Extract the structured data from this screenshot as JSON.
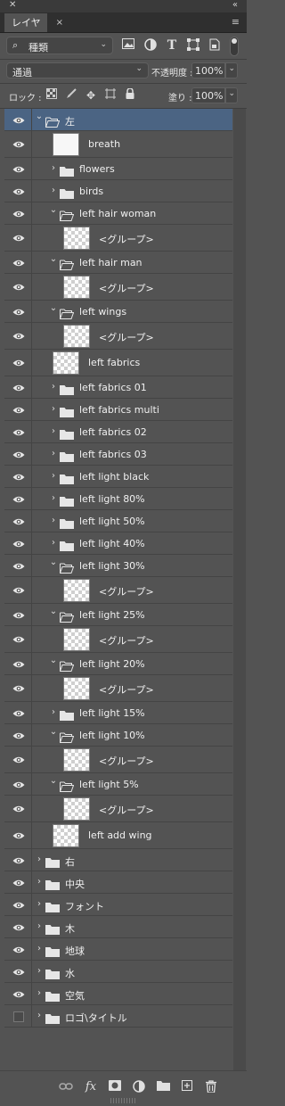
{
  "panel": {
    "tab_title": "レイヤー",
    "menu_icon": "panel-menu-icon"
  },
  "filter": {
    "kind_label": "種類"
  },
  "blend": {
    "mode": "通過",
    "opacity_label": "不透明度 :",
    "opacity_value": "100%"
  },
  "locks": {
    "label": "ロック :",
    "fill_label": "塗り :",
    "fill_value": "100%"
  },
  "layers": [
    {
      "name": "左",
      "kind": "group-open",
      "indent": 0,
      "visible": true,
      "selected": true
    },
    {
      "name": "breath",
      "kind": "layer",
      "indent": 1,
      "visible": true,
      "thumb": "plain"
    },
    {
      "name": "flowers",
      "kind": "group-closed",
      "indent": 1,
      "visible": true
    },
    {
      "name": "birds",
      "kind": "group-closed",
      "indent": 1,
      "visible": true
    },
    {
      "name": "left hair woman",
      "kind": "group-open",
      "indent": 1,
      "visible": true
    },
    {
      "name": "<グループ>",
      "kind": "layer",
      "indent": 2,
      "visible": true,
      "thumb": "checker"
    },
    {
      "name": "left hair man",
      "kind": "group-open",
      "indent": 1,
      "visible": true
    },
    {
      "name": "<グループ>",
      "kind": "layer",
      "indent": 2,
      "visible": true,
      "thumb": "checker"
    },
    {
      "name": "left wings",
      "kind": "group-open",
      "indent": 1,
      "visible": true
    },
    {
      "name": "<グループ>",
      "kind": "layer",
      "indent": 2,
      "visible": true,
      "thumb": "checker"
    },
    {
      "name": "left fabrics",
      "kind": "layer",
      "indent": 1,
      "visible": true,
      "thumb": "checker"
    },
    {
      "name": "left fabrics 01",
      "kind": "group-closed",
      "indent": 1,
      "visible": true
    },
    {
      "name": "left fabrics multi",
      "kind": "group-closed",
      "indent": 1,
      "visible": true
    },
    {
      "name": "left fabrics 02",
      "kind": "group-closed",
      "indent": 1,
      "visible": true
    },
    {
      "name": "left fabrics 03",
      "kind": "group-closed",
      "indent": 1,
      "visible": true
    },
    {
      "name": "left light black",
      "kind": "group-closed",
      "indent": 1,
      "visible": true
    },
    {
      "name": "left light 80%",
      "kind": "group-closed",
      "indent": 1,
      "visible": true
    },
    {
      "name": "left light 50%",
      "kind": "group-closed",
      "indent": 1,
      "visible": true
    },
    {
      "name": "left light 40%",
      "kind": "group-closed",
      "indent": 1,
      "visible": true
    },
    {
      "name": "left light 30%",
      "kind": "group-open",
      "indent": 1,
      "visible": true
    },
    {
      "name": "<グループ>",
      "kind": "layer",
      "indent": 2,
      "visible": true,
      "thumb": "checker"
    },
    {
      "name": "left light 25%",
      "kind": "group-open",
      "indent": 1,
      "visible": true
    },
    {
      "name": "<グループ>",
      "kind": "layer",
      "indent": 2,
      "visible": true,
      "thumb": "checker"
    },
    {
      "name": "left light 20%",
      "kind": "group-open",
      "indent": 1,
      "visible": true
    },
    {
      "name": "<グループ>",
      "kind": "layer",
      "indent": 2,
      "visible": true,
      "thumb": "checker"
    },
    {
      "name": "left light 15%",
      "kind": "group-closed",
      "indent": 1,
      "visible": true
    },
    {
      "name": "left light 10%",
      "kind": "group-open",
      "indent": 1,
      "visible": true
    },
    {
      "name": "<グループ>",
      "kind": "layer",
      "indent": 2,
      "visible": true,
      "thumb": "checker"
    },
    {
      "name": "left light 5%",
      "kind": "group-open",
      "indent": 1,
      "visible": true
    },
    {
      "name": "<グループ>",
      "kind": "layer",
      "indent": 2,
      "visible": true,
      "thumb": "checker"
    },
    {
      "name": "left add wing",
      "kind": "layer",
      "indent": 1,
      "visible": true,
      "thumb": "checker"
    },
    {
      "name": "右",
      "kind": "group-closed",
      "indent": 0,
      "visible": true
    },
    {
      "name": "中央",
      "kind": "group-closed",
      "indent": 0,
      "visible": true
    },
    {
      "name": "フォント",
      "kind": "group-closed",
      "indent": 0,
      "visible": true
    },
    {
      "name": "木",
      "kind": "group-closed",
      "indent": 0,
      "visible": true
    },
    {
      "name": "地球",
      "kind": "group-closed",
      "indent": 0,
      "visible": true
    },
    {
      "name": "水",
      "kind": "group-closed",
      "indent": 0,
      "visible": true
    },
    {
      "name": "空気",
      "kind": "group-closed",
      "indent": 0,
      "visible": true
    },
    {
      "name": "ロゴ\\タイトル",
      "kind": "group-closed",
      "indent": 0,
      "visible": false
    }
  ],
  "bottom_icons": [
    "link-icon",
    "fx-icon",
    "mask-icon",
    "adjustment-icon",
    "new-group-icon",
    "new-layer-icon",
    "trash-icon"
  ]
}
